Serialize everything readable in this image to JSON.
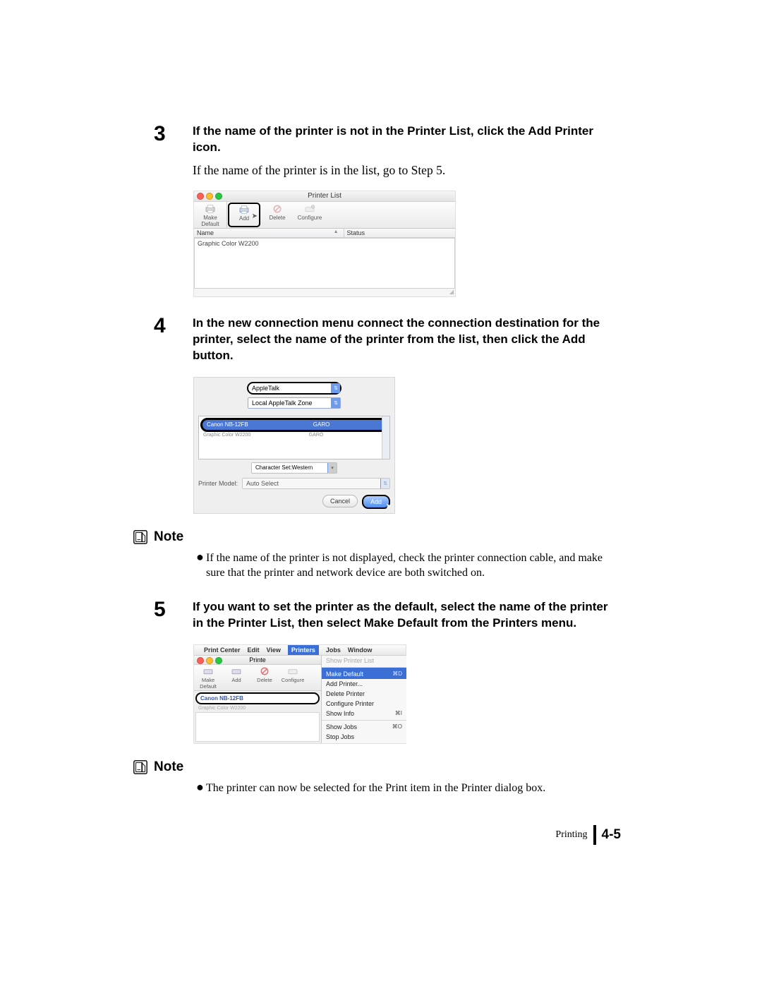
{
  "steps": {
    "s3": {
      "num": "3",
      "title": "If the name of the printer is not in the Printer List, click the Add Printer icon.",
      "sub": "If the name of the printer is in the list, go to Step 5."
    },
    "s4": {
      "num": "4",
      "title": "In the new connection menu connect the connection destination for the printer, select the name of the printer from the list, then click the Add button."
    },
    "s5": {
      "num": "5",
      "title": "If you want to set the printer as the default, select the name of the printer in the Printer List, then select Make Default from the Printers menu."
    }
  },
  "shot1": {
    "window_title": "Printer List",
    "toolbar": [
      "Make Default",
      "Add",
      "Delete",
      "Configure"
    ],
    "cols": {
      "name": "Name",
      "status": "Status"
    },
    "row": "Graphic Color W2200"
  },
  "shot2": {
    "conn_type": "AppleTalk",
    "zone": "Local AppleTalk Zone",
    "row_name": "Canon NB-12FB",
    "row_type": "GARO",
    "row2_name": "Graphic Color W2200",
    "row2_type": "GARO",
    "charset": "Character Set:Western",
    "model_label": "Printer Model:",
    "model_value": "Auto Select",
    "btn_cancel": "Cancel",
    "btn_add": "Add"
  },
  "notes": {
    "title": "Note",
    "n1": "If the name of the printer is not displayed, check the printer connection cable, and make sure that the printer and network device are both switched on.",
    "n2": "The printer can now be selected for the Print item in the Printer dialog box."
  },
  "shot3": {
    "menubar": [
      "Print Center",
      "Edit",
      "View",
      "Printers",
      "Jobs",
      "Window"
    ],
    "left_title": "Printe",
    "toolbar": [
      "Make Default",
      "Add",
      "Delete",
      "Configure"
    ],
    "sel_row": "Canon NB-12FB",
    "row2": "Graphic Color W2200",
    "menu": [
      {
        "label": "Show Printer List",
        "sc": "",
        "dim": true
      },
      {
        "label": "Make Default",
        "sc": "⌘D",
        "hl": true
      },
      {
        "label": "Add Printer...",
        "sc": ""
      },
      {
        "label": "Delete Printer",
        "sc": ""
      },
      {
        "label": "Configure Printer",
        "sc": ""
      },
      {
        "label": "Show Info",
        "sc": "⌘I",
        "div": false
      },
      {
        "label": "Show Jobs",
        "sc": "⌘O",
        "div": true
      },
      {
        "label": "Stop Jobs",
        "sc": ""
      }
    ]
  },
  "footer": {
    "chapter": "Printing",
    "page": "4-5"
  }
}
